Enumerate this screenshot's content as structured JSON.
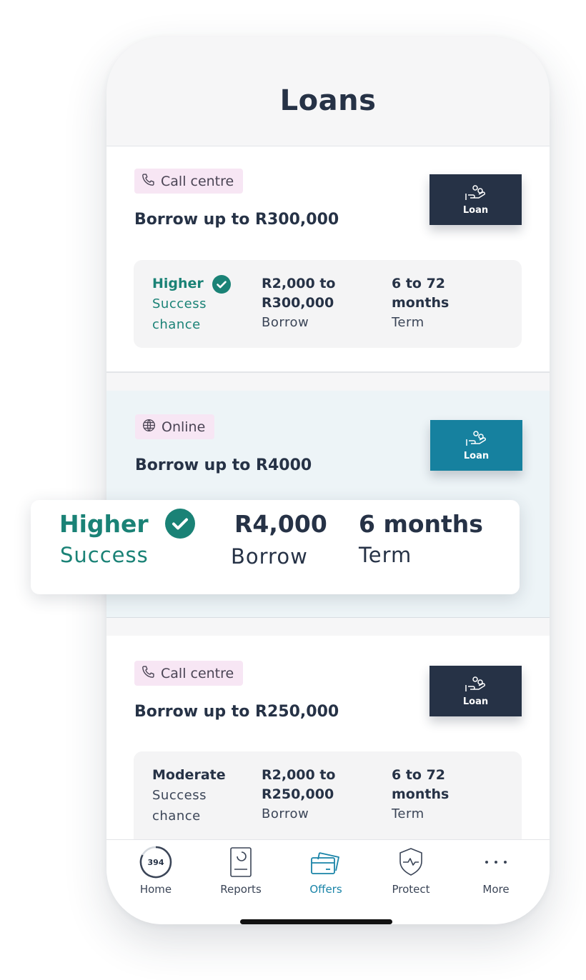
{
  "header": {
    "title": "Loans"
  },
  "offers": [
    {
      "channel": "Call centre",
      "channel_icon": "phone-icon",
      "headline": "Borrow up to R300,000",
      "badge": "Loan",
      "chance_level": "Higher",
      "chance_label_1": "Success",
      "chance_label_2": "chance",
      "amount_line_1": "R2,000 to",
      "amount_line_2": "R300,000",
      "amount_label": "Borrow",
      "term_line_1": "6 to 72",
      "term_line_2": "months",
      "term_label": "Term"
    },
    {
      "channel": "Online",
      "channel_icon": "globe-icon",
      "headline": "Borrow up to R4000",
      "badge": "Loan",
      "chance_level": "Higher",
      "chance_label": "Success",
      "amount": "R4,000",
      "amount_label": "Borrow",
      "term": "6 months",
      "term_label": "Term"
    },
    {
      "channel": "Call centre",
      "channel_icon": "phone-icon",
      "headline": "Borrow up to R250,000",
      "badge": "Loan",
      "chance_level": "Moderate",
      "chance_label_1": "Success",
      "chance_label_2": "chance",
      "amount_line_1": "R2,000 to",
      "amount_line_2": "R250,000",
      "amount_label": "Borrow",
      "term_line_1": "6 to 72",
      "term_line_2": "months",
      "term_label": "Term"
    }
  ],
  "nav": {
    "home": {
      "label": "Home",
      "score": "394",
      "icon": "score-ring-icon"
    },
    "reports": {
      "label": "Reports",
      "icon": "report-icon"
    },
    "offers": {
      "label": "Offers",
      "icon": "cards-icon",
      "active": true
    },
    "protect": {
      "label": "Protect",
      "icon": "shield-icon"
    },
    "more": {
      "label": "More",
      "icon": "more-dots-icon"
    }
  },
  "colors": {
    "navy": "#263246",
    "teal_accent": "#16819f",
    "success_green": "#1a8276",
    "chip_pink": "#f7e6f4",
    "highlight_bg": "#edf4f7"
  }
}
